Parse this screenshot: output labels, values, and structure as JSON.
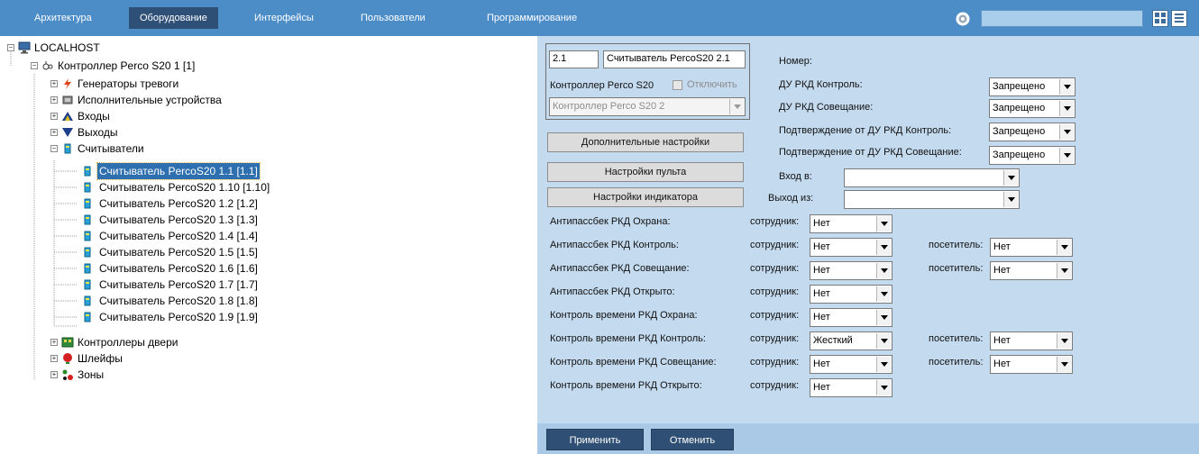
{
  "tabs": [
    "Архитектура",
    "Оборудование",
    "Интерфейсы",
    "Пользователи",
    "Программирование"
  ],
  "tree": {
    "root": "LOCALHOST",
    "controller": "Контроллер Perco S20 1 [1]",
    "groups": {
      "alarm_generators": "Генераторы тревоги",
      "actuators": "Исполнительные устройства",
      "inputs": "Входы",
      "outputs": "Выходы",
      "readers": "Считыватели",
      "door_controllers": "Контроллеры двери",
      "loops": "Шлейфы",
      "zones": "Зоны"
    },
    "readers": [
      "Считыватель PercoS20 1.1 [1.1]",
      "Считыватель PercoS20 1.10 [1.10]",
      "Считыватель PercoS20 1.2 [1.2]",
      "Считыватель PercoS20 1.3 [1.3]",
      "Считыватель PercoS20 1.4 [1.4]",
      "Считыватель PercoS20 1.5 [1.5]",
      "Считыватель PercoS20 1.6 [1.6]",
      "Считыватель PercoS20 1.7 [1.7]",
      "Считыватель PercoS20 1.8 [1.8]",
      "Считыватель PercoS20 1.9 [1.9]"
    ]
  },
  "form": {
    "number": "2.1",
    "name": "Считыватель PercoS20 2.1",
    "controller_label": "Контроллер Perco S20",
    "disable_label": "Отключить",
    "controller_select": "Контроллер Perco S20 2",
    "btn_extra": "Дополнительные настройки",
    "btn_console": "Настройки пульта",
    "btn_indicator": "Настройки индикатора",
    "number_label": "Номер:",
    "du_rkd_control": "ДУ РКД Контроль:",
    "du_rkd_meeting": "ДУ РКД Совещание:",
    "confirm_control": "Подтверждение от ДУ РКД Контроль:",
    "confirm_meeting": "Подтверждение от ДУ РКД Совещание:",
    "forbidden": "Запрещено",
    "entry_label": "Вход в:",
    "exit_label": "Выход из:",
    "employee": "сотрудник:",
    "visitor": "посетитель:",
    "rows": [
      {
        "label": "Антипассбек РКД Охрана:",
        "emp": "Нет"
      },
      {
        "label": "Антипассбек РКД Контроль:",
        "emp": "Нет",
        "vis": "Нет"
      },
      {
        "label": "Антипассбек РКД Совещание:",
        "emp": "Нет",
        "vis": "Нет"
      },
      {
        "label": "Антипассбек РКД Открыто:",
        "emp": "Нет"
      },
      {
        "label": "Контроль времени РКД Охрана:",
        "emp": "Нет"
      },
      {
        "label": "Контроль времени РКД Контроль:",
        "emp": "Жесткий",
        "vis": "Нет"
      },
      {
        "label": "Контроль времени РКД Совещание:",
        "emp": "Нет",
        "vis": "Нет"
      },
      {
        "label": "Контроль времени РКД Открыто:",
        "emp": "Нет"
      }
    ]
  },
  "footer": {
    "apply": "Применить",
    "cancel": "Отменить"
  },
  "colors": {
    "topbar": "#4c8dc8",
    "active_tab": "#2e4f76",
    "panel": "#c4daee",
    "footer": "#a9c9e6",
    "selection": "#2e6fb0"
  }
}
